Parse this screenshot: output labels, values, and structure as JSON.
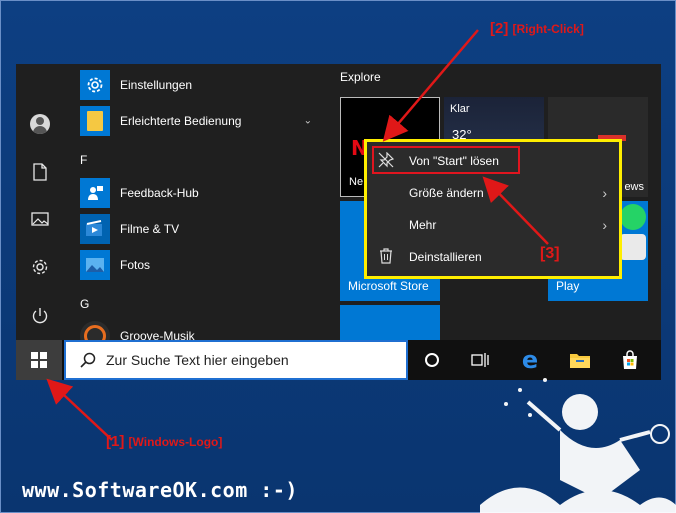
{
  "start_menu": {
    "apps": [
      {
        "label": "Einstellungen",
        "icon": "gear-icon"
      },
      {
        "label": "Erleichterte Bedienung",
        "icon": "accessibility-folder-icon"
      },
      {
        "label": "Feedback-Hub",
        "icon": "feedback-icon"
      },
      {
        "label": "Filme & TV",
        "icon": "play-icon"
      },
      {
        "label": "Fotos",
        "icon": "photo-icon"
      },
      {
        "label": "Groove-Musik",
        "icon": "music-icon"
      }
    ],
    "letters": [
      "F",
      "G"
    ],
    "group_title": "Explore",
    "tiles": {
      "netflix_label": "Ne",
      "netflix_logo": "N",
      "weather_label": "Klar",
      "weather_temp": "32°",
      "news_label": "ews",
      "store_label": "Microsoft Store",
      "play_label": "Play"
    }
  },
  "context_menu": {
    "items": [
      {
        "label": "Von \"Start\" lösen",
        "icon": "unpin-icon"
      },
      {
        "label": "Größe ändern",
        "icon": "",
        "has_submenu": true
      },
      {
        "label": "Mehr",
        "icon": "",
        "has_submenu": true
      },
      {
        "label": "Deinstallieren",
        "icon": "trash-icon"
      }
    ]
  },
  "taskbar": {
    "search_placeholder": "Zur Suche Text hier eingeben"
  },
  "annotations": {
    "step1": "[1]",
    "step1_text": "[Windows-Logo]",
    "step2": "[2]",
    "step2_text": "[Right-Click]",
    "step3": "[3]",
    "brand": "www.SoftwareOK.com :-)"
  },
  "colors": {
    "accent": "#0078d4",
    "highlight": "#e0151f",
    "context_border": "#ffee00",
    "background": "#0b3a78"
  }
}
